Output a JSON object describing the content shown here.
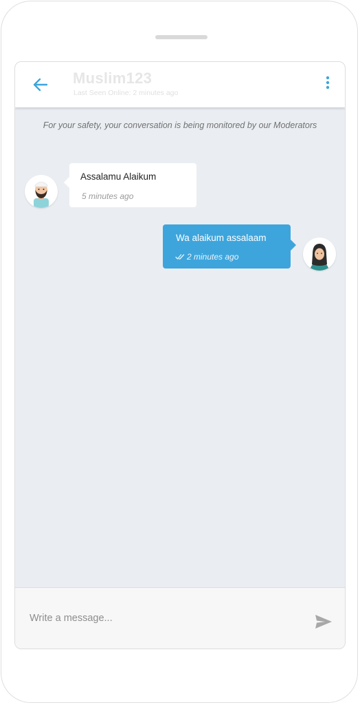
{
  "header": {
    "title": "Muslim123",
    "last_seen": "Last Seen Online: 2 minutes ago",
    "back_icon": "arrow-left-icon",
    "menu_icon": "more-vertical-icon",
    "accent_color": "#3ea5dc"
  },
  "notice": {
    "text": "For your safety, your conversation is being monitored by our Moderators"
  },
  "messages": [
    {
      "direction": "incoming",
      "text": "Assalamu Alaikum",
      "time": "5 minutes ago",
      "avatar": "male-avatar-icon"
    },
    {
      "direction": "outgoing",
      "text": "Wa alaikum assalaam",
      "time": "2 minutes ago",
      "status_icon": "double-check-icon",
      "avatar": "female-hijab-avatar-icon",
      "bubble_color": "#3ea5dc"
    }
  ],
  "composer": {
    "placeholder": "Write a message...",
    "value": "",
    "send_icon": "send-icon"
  }
}
